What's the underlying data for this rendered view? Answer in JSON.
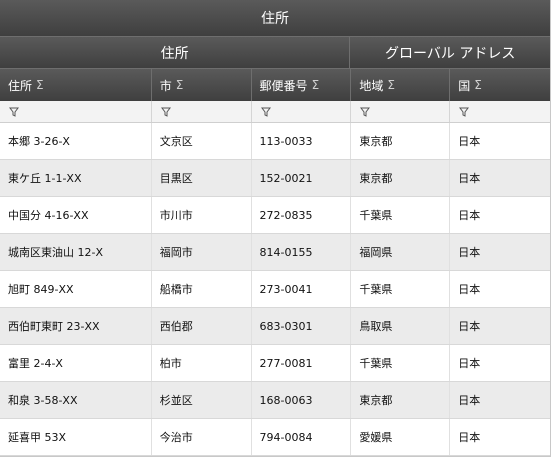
{
  "title": "住所",
  "groups": [
    {
      "label": "住所"
    },
    {
      "label": "グローバル アドレス"
    }
  ],
  "columns": [
    {
      "label": "住所",
      "sum_icon": "Σ"
    },
    {
      "label": "市",
      "sum_icon": "Σ"
    },
    {
      "label": "郵便番号",
      "sum_icon": "Σ"
    },
    {
      "label": "地域",
      "sum_icon": "Σ"
    },
    {
      "label": "国",
      "sum_icon": "Σ"
    }
  ],
  "filter_icon": "filter-icon",
  "rows": [
    [
      "本郷 3-26-X",
      "文京区",
      "113-0033",
      "東京都",
      "日本"
    ],
    [
      "東ケ丘 1-1-XX",
      "目黒区",
      "152-0021",
      "東京都",
      "日本"
    ],
    [
      "中国分 4-16-XX",
      "市川市",
      "272-0835",
      "千葉県",
      "日本"
    ],
    [
      "城南区東油山 12-X",
      "福岡市",
      "814-0155",
      "福岡県",
      "日本"
    ],
    [
      "旭町 849-XX",
      "船橋市",
      "273-0041",
      "千葉県",
      "日本"
    ],
    [
      "西伯町東町 23-XX",
      "西伯郡",
      "683-0301",
      "鳥取県",
      "日本"
    ],
    [
      "富里 2-4-X",
      "柏市",
      "277-0081",
      "千葉県",
      "日本"
    ],
    [
      "和泉 3-58-XX",
      "杉並区",
      "168-0063",
      "東京都",
      "日本"
    ],
    [
      "延喜甲 53X",
      "今治市",
      "794-0084",
      "愛媛県",
      "日本"
    ]
  ],
  "colors": {
    "header_bg": "#4a4a4a",
    "alt_row": "#ebebeb",
    "filter_row": "#f3f3f3"
  }
}
